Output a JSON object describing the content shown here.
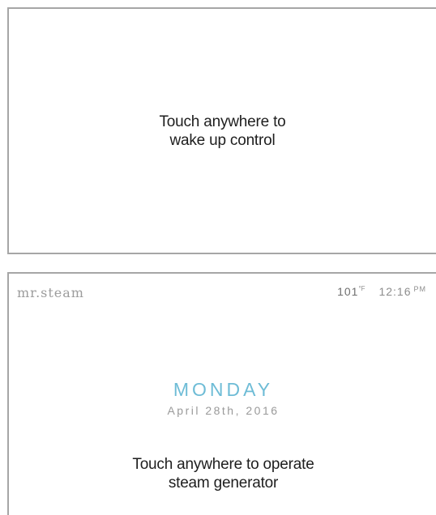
{
  "sleep_screen": {
    "message_line1": "Touch anywhere to",
    "message_line2": "wake up control"
  },
  "home_screen": {
    "brand": "mr.steam",
    "temperature": "101",
    "temperature_unit": "°F",
    "time": "12:16",
    "time_period": "PM",
    "day": "MONDAY",
    "date": "April 28th, 2016",
    "message_line1": "Touch anywhere to operate",
    "message_line2": "steam generator"
  },
  "colors": {
    "accent": "#6ebcd6",
    "border": "#a6a6a6",
    "text": "#1e1e1e",
    "muted": "#9a9a9a"
  }
}
